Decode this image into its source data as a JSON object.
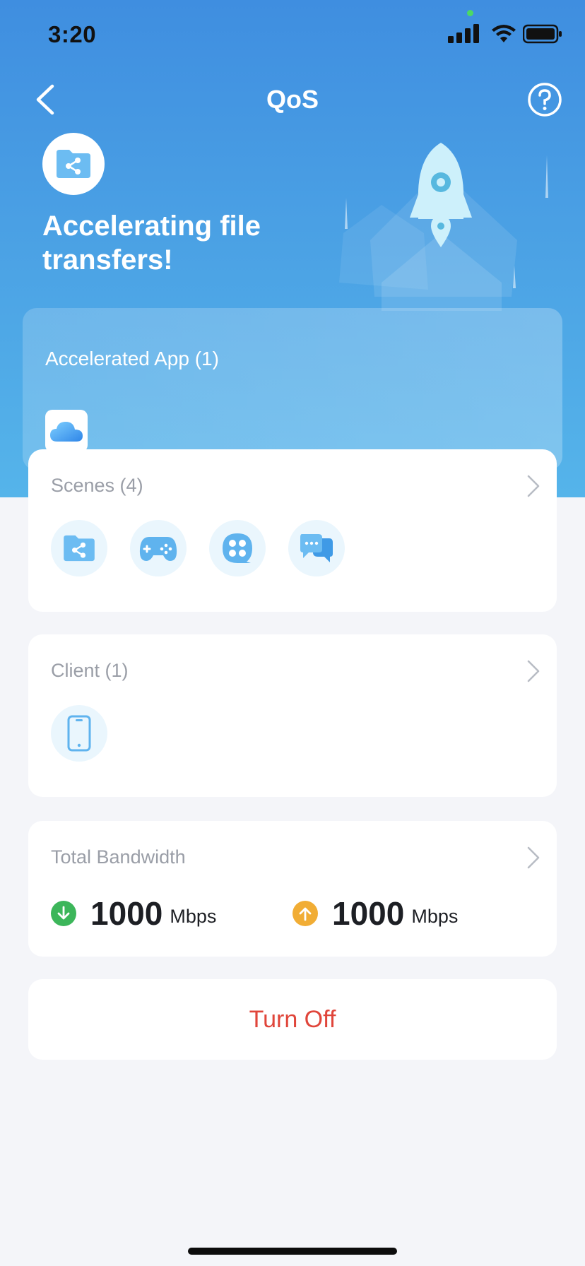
{
  "status_bar": {
    "time": "3:20"
  },
  "nav": {
    "title": "QoS"
  },
  "hero": {
    "headline": "Accelerating file transfers!",
    "accelerated_app_title": "Accelerated App (1)"
  },
  "scenes": {
    "title": "Scenes (4)",
    "icons": [
      "file-share-icon",
      "gamepad-icon",
      "video-icon",
      "chat-icon"
    ]
  },
  "client": {
    "title": "Client (1)",
    "icons": [
      "phone-icon"
    ]
  },
  "bandwidth": {
    "title": "Total Bandwidth",
    "download_value": "1000",
    "download_unit": "Mbps",
    "upload_value": "1000",
    "upload_unit": "Mbps"
  },
  "actions": {
    "turn_off_label": "Turn Off"
  },
  "colors": {
    "accent_blue": "#4a9fe3",
    "download_green": "#3cb65a",
    "upload_orange": "#f1ad35",
    "danger_red": "#e0453a"
  }
}
